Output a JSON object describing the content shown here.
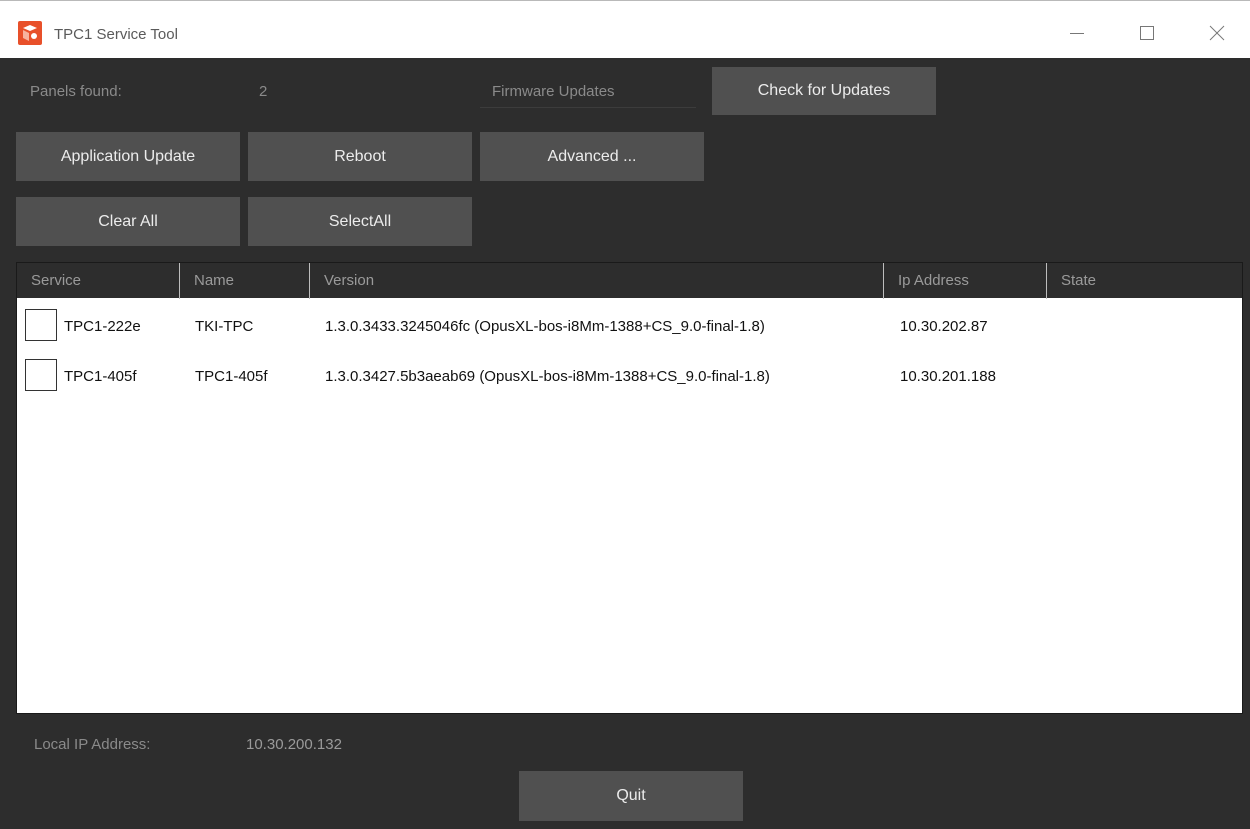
{
  "window": {
    "title": "TPC1 Service Tool",
    "accent_color": "#e8502a"
  },
  "panels": {
    "label": "Panels found:",
    "count": "2"
  },
  "firmware": {
    "label": "Firmware Updates",
    "check_button": "Check for Updates"
  },
  "actions": {
    "application_update": "Application Update",
    "reboot": "Reboot",
    "advanced": "Advanced ...",
    "clear_all": "Clear All",
    "select_all": "SelectAll"
  },
  "table": {
    "columns": [
      "Service",
      "Name",
      "Version",
      "Ip Address",
      "State"
    ],
    "rows": [
      {
        "selected": false,
        "service": "TPC1-222e",
        "name": "TKI-TPC",
        "version": "1.3.0.3433.3245046fc (OpusXL-bos-i8Mm-1388+CS_9.0-final-1.8)",
        "ip": "10.30.202.87",
        "state": ""
      },
      {
        "selected": false,
        "service": "TPC1-405f",
        "name": "TPC1-405f",
        "version": "1.3.0.3427.5b3aeab69 (OpusXL-bos-i8Mm-1388+CS_9.0-final-1.8)",
        "ip": "10.30.201.188",
        "state": ""
      }
    ]
  },
  "footer": {
    "local_ip_label": "Local IP Address:",
    "local_ip_value": "10.30.200.132",
    "quit_button": "Quit"
  },
  "icons": {
    "app": "app-logo-icon",
    "minimize": "minimize-icon",
    "maximize": "maximize-icon",
    "close": "close-icon"
  }
}
